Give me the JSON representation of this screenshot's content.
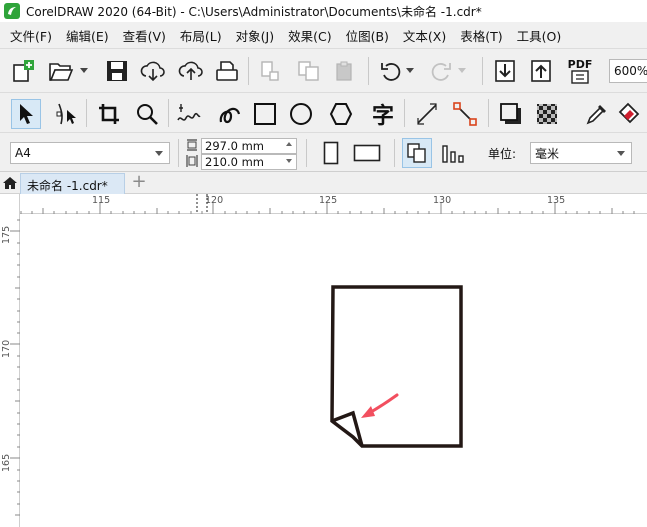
{
  "window": {
    "title": "CorelDRAW 2020 (64-Bit) - C:\\Users\\Administrator\\Documents\\未命名 -1.cdr*"
  },
  "menu": [
    "文件(F)",
    "编辑(E)",
    "查看(V)",
    "布局(L)",
    "对象(J)",
    "效果(C)",
    "位图(B)",
    "文本(X)",
    "表格(T)",
    "工具(O)"
  ],
  "toolbar": {
    "pdf_label": "PDF",
    "zoom_value": "600%",
    "text_tool_glyph": "字"
  },
  "property_bar": {
    "page_size": "A4",
    "width": "297.0 mm",
    "height": "210.0 mm",
    "units_label": "单位:",
    "units_value": "毫米"
  },
  "document_tab": {
    "label": "未命名 -1.cdr*"
  },
  "ruler": {
    "horizontal_labels": [
      "115",
      "120",
      "125",
      "130",
      "135"
    ],
    "vertical_labels": [
      "175",
      "170",
      "165"
    ]
  },
  "colors": {
    "brand_green": "#2fa43a",
    "arrow_annotation": "#f24f5f",
    "tab_active": "#dbe8f5"
  }
}
